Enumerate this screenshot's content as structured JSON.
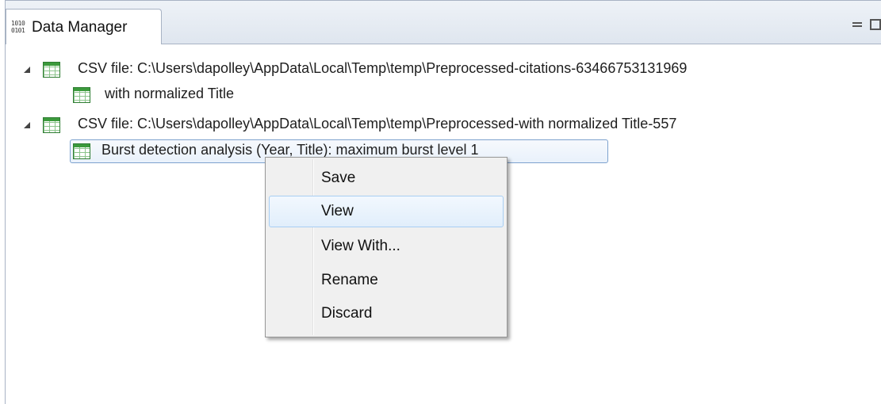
{
  "view": {
    "tab_label": "Data Manager",
    "tab_icon_text_line1": "1010",
    "tab_icon_text_line2": "0101"
  },
  "tree": {
    "items": [
      {
        "label": "CSV file: C:\\Users\\dapolley\\AppData\\Local\\Temp\\temp\\Preprocessed-citations-63466753131969",
        "expanded": true
      },
      {
        "label": "with normalized Title"
      },
      {
        "label": "CSV file: C:\\Users\\dapolley\\AppData\\Local\\Temp\\temp\\Preprocessed-with normalized Title-557",
        "expanded": true
      },
      {
        "label": "Burst detection analysis (Year, Title): maximum burst level 1",
        "selected": true
      }
    ]
  },
  "context_menu": {
    "items": [
      {
        "label": "Save"
      },
      {
        "label": "View",
        "hovered": true
      },
      {
        "label": "View With..."
      },
      {
        "label": "Rename"
      },
      {
        "label": "Discard"
      }
    ]
  },
  "colors": {
    "tab_border": "#a8b3c4",
    "selection_border": "#7da2ce",
    "menu_hover_border": "#a8cef3",
    "table_icon_green": "#3c9a3c"
  }
}
